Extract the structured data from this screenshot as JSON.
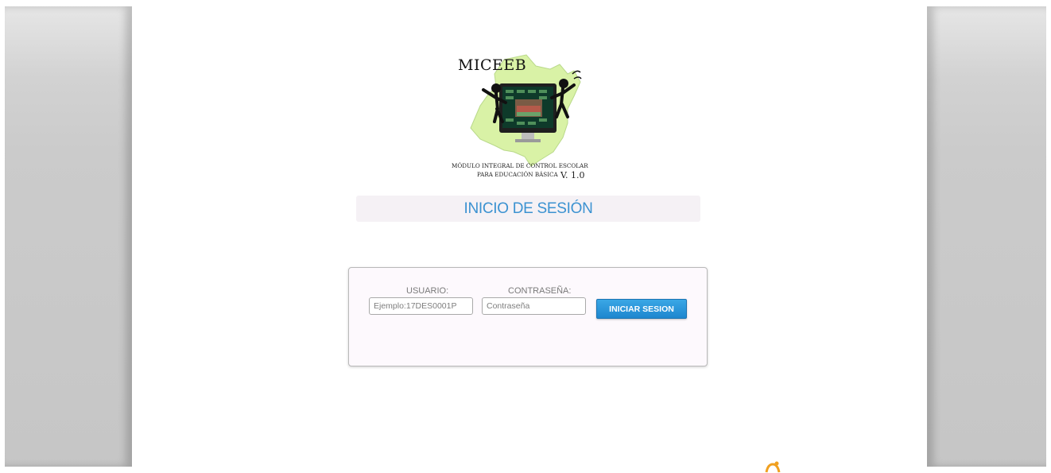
{
  "logo": {
    "title": "MICEEB",
    "subtitle_line1": "MÓDULO INTEGRAL DE CONTROL ESCOLAR",
    "subtitle_line2": "PARA EDUCACIÓN BÁSICA",
    "version": "V. 1.0"
  },
  "header": {
    "title": "INICIO DE SESIÓN"
  },
  "login": {
    "user_label": "USUARIO:",
    "user_placeholder": "Ejemplo:17DES0001P",
    "user_value": "",
    "password_label": "CONTRASEÑA:",
    "password_placeholder": "Contraseña",
    "password_value": "",
    "submit_label": "INICIAR SESION"
  },
  "colors": {
    "accent": "#3b92d1",
    "button": "#2796dc",
    "map_green": "#d7f1a4"
  },
  "icons": {
    "corner": "orange-logo-icon"
  }
}
